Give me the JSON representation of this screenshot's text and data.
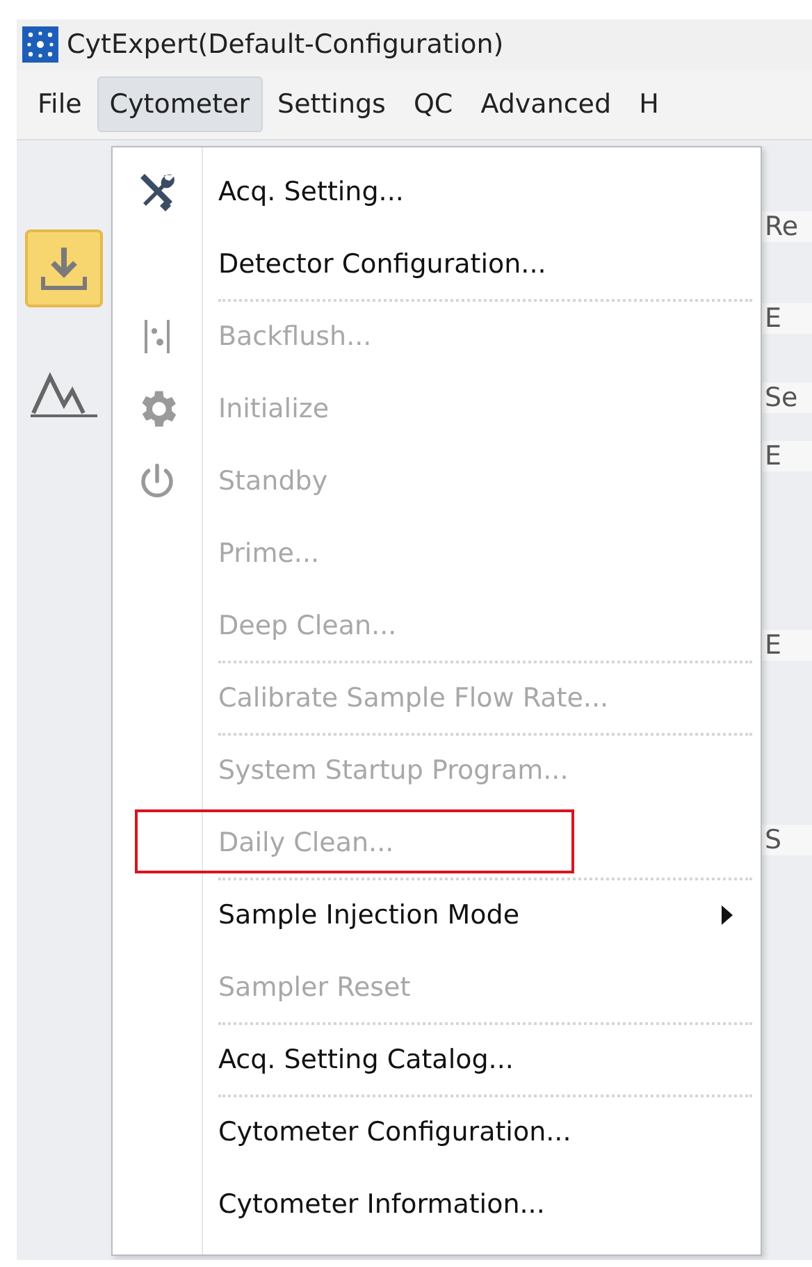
{
  "window": {
    "title": "CytExpert(Default-Configuration)"
  },
  "menubar": [
    {
      "label": "File",
      "selected": false
    },
    {
      "label": "Cytometer",
      "selected": true
    },
    {
      "label": "Settings",
      "selected": false
    },
    {
      "label": "QC",
      "selected": false
    },
    {
      "label": "Advanced",
      "selected": false
    },
    {
      "label": "H",
      "selected": false
    }
  ],
  "background_fragments": [
    "Re",
    "E",
    "Se",
    "E",
    "E",
    "S"
  ],
  "menu": [
    {
      "label": "Acq. Setting...",
      "disabled": false,
      "kind": "wrench"
    },
    {
      "label": "Detector Configuration...",
      "disabled": false,
      "separator_after": true
    },
    {
      "label": "Backflush...",
      "disabled": true,
      "kind": "flush"
    },
    {
      "label": "Initialize",
      "disabled": true,
      "kind": "gear"
    },
    {
      "label": "Standby",
      "disabled": true,
      "kind": "power"
    },
    {
      "label": "Prime...",
      "disabled": true
    },
    {
      "label": "Deep Clean...",
      "disabled": true,
      "separator_after": true
    },
    {
      "label": "Calibrate Sample Flow Rate...",
      "disabled": true,
      "separator_after": true
    },
    {
      "label": "System Startup Program...",
      "disabled": true
    },
    {
      "label": "Daily Clean...",
      "disabled": true,
      "highlighted": true,
      "separator_after": true
    },
    {
      "label": "Sample Injection Mode",
      "disabled": false,
      "submenu": true
    },
    {
      "label": "Sampler Reset",
      "disabled": true,
      "separator_after": true
    },
    {
      "label": "Acq. Setting Catalog...",
      "disabled": false,
      "separator_after": true
    },
    {
      "label": "Cytometer Configuration...",
      "disabled": false
    },
    {
      "label": "Cytometer Information...",
      "disabled": false
    }
  ]
}
